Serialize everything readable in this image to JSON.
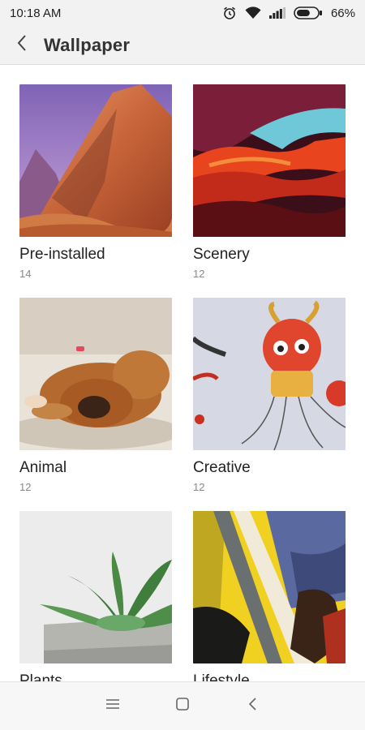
{
  "status_bar": {
    "time": "10:18 AM",
    "battery_percent": "66%",
    "battery_level": 0.66,
    "icons": [
      "alarm-icon",
      "wifi-icon",
      "signal-icon",
      "battery-icon"
    ]
  },
  "header": {
    "title": "Wallpaper",
    "back_icon": "back-arrow-icon"
  },
  "categories": [
    {
      "name": "Pre-installed",
      "count": "14"
    },
    {
      "name": "Scenery",
      "count": "12"
    },
    {
      "name": "Animal",
      "count": "12"
    },
    {
      "name": "Creative",
      "count": "12"
    },
    {
      "name": "Plants",
      "count": ""
    },
    {
      "name": "Lifestyle",
      "count": ""
    }
  ],
  "navbar": {
    "icons": [
      "menu-icon",
      "home-icon",
      "back-icon"
    ]
  },
  "colors": {
    "header_bg": "#f2f2f2",
    "text_primary": "#222222",
    "text_secondary": "#888888"
  }
}
